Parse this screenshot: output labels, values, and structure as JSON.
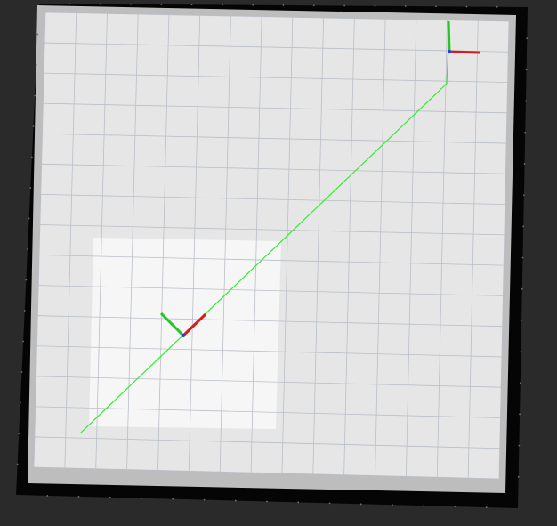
{
  "scene": {
    "background_color": "#2a2a2a",
    "map_border_color": "#050505",
    "map_occupied_edge_color": "#bdbdbd",
    "map_free_color": "#e6e6e6",
    "map_free_light_color": "#f6f6f6",
    "grid_color": "#b9bfc7",
    "path_color": "#2bf02b",
    "axis_x_color": "#d81b1b",
    "axis_y_color": "#21c821",
    "axis_origin_color": "#1e3cff"
  },
  "icons": {
    "robot_frame": "axes-frame-icon",
    "goal_frame": "axes-frame-icon"
  }
}
